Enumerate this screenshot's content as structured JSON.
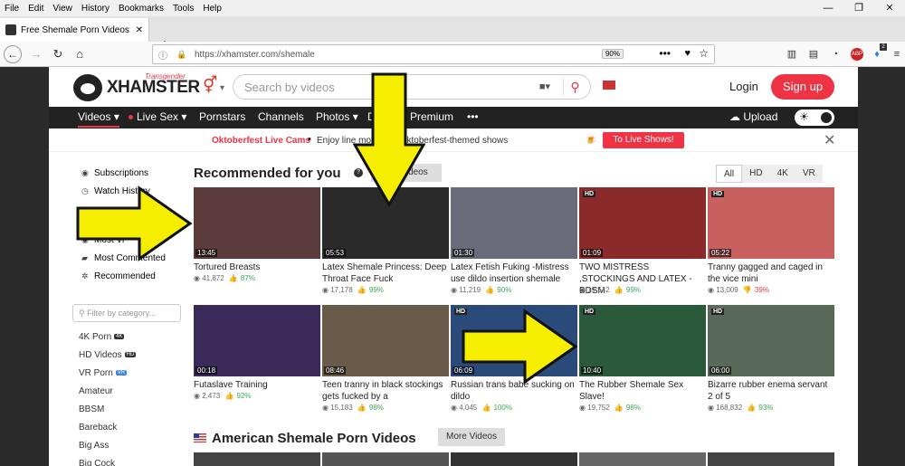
{
  "browser": {
    "menu": [
      "File",
      "Edit",
      "View",
      "History",
      "Bookmarks",
      "Tools",
      "Help"
    ],
    "tab_title": "Free Shemale Porn Videos: Tra",
    "url": "https://xhamster.com/shemale",
    "zoom": "90%",
    "badge_count": "2"
  },
  "header": {
    "logo": "XHAMSTER",
    "logo_sub": "Transgender",
    "search_placeholder": "Search by videos",
    "login": "Login",
    "signup": "Sign up"
  },
  "nav": {
    "videos": "Videos",
    "live": "Live Sex",
    "pornstars": "Pornstars",
    "channels": "Channels",
    "photos": "Photos",
    "dating": "D",
    "premium": "Premium",
    "more": "•••",
    "upload": "Upload"
  },
  "promo": {
    "title": "Oktoberfest Live Cams",
    "text": "Enjoy   line models in Oktoberfest-themed shows",
    "button": "To Live Shows!"
  },
  "sidebar": {
    "items": [
      "Subscriptions",
      "Watch History",
      "Most Vi",
      "Most Commented",
      "Recommended"
    ],
    "filter_placeholder": "Filter by category...",
    "categories": [
      "4K Porn",
      "HD Videos",
      "VR Porn",
      "Amateur",
      "BBSM",
      "Bareback",
      "Big Ass",
      "Big Cock"
    ],
    "badge_4k": "4K",
    "badge_hd": "HD",
    "badge_vr": "VR"
  },
  "section1": {
    "title": "Recommended for you",
    "more": "ore Videos",
    "filters": [
      "All",
      "HD",
      "4K",
      "VR"
    ]
  },
  "videos": [
    {
      "dur": "13:45",
      "title": "Tortured Breasts",
      "views": "41,872",
      "rating": "87%",
      "hd": ""
    },
    {
      "dur": "05:53",
      "title": "Latex Shemale Princess: Deep Throat Face Fuck",
      "views": "17,178",
      "rating": "99%",
      "hd": ""
    },
    {
      "dur": "01:30",
      "title": "Latex Fetish Fuking -Mistress use dildo insertion shemale",
      "views": "11,219",
      "rating": "90%",
      "hd": ""
    },
    {
      "dur": "01:09",
      "title": "TWO MISTRESS ,STOCKINGS AND LATEX -BDSM",
      "views": "19,542",
      "rating": "99%",
      "hd": "HD"
    },
    {
      "dur": "05:22",
      "title": "Tranny gagged and caged in the vice mini",
      "views": "13,009",
      "rating": "39%",
      "hd": "HD"
    },
    {
      "dur": "00:18",
      "title": "Futaslave Training",
      "views": "2,473",
      "rating": "92%",
      "hd": ""
    },
    {
      "dur": "08:46",
      "title": "Teen tranny in black stockings gets fucked by a",
      "views": "15,183",
      "rating": "98%",
      "hd": ""
    },
    {
      "dur": "06:09",
      "title": "Russian trans babe sucking on dildo",
      "views": "4,045",
      "rating": "100%",
      "hd": "HD"
    },
    {
      "dur": "10:40",
      "title": "The Rubber Shemale Sex Slave!",
      "views": "19,752",
      "rating": "98%",
      "hd": "HD"
    },
    {
      "dur": "06:00",
      "title": "Bizarre rubber enema servant 2 of 5",
      "views": "168,832",
      "rating": "93%",
      "hd": "HD"
    }
  ],
  "section2": {
    "title": "American Shemale Porn Videos",
    "more": "More Videos"
  },
  "colors": {
    "accent": "#e34040",
    "arrow": "#f5ee00",
    "rating_good": "#3aa757"
  }
}
